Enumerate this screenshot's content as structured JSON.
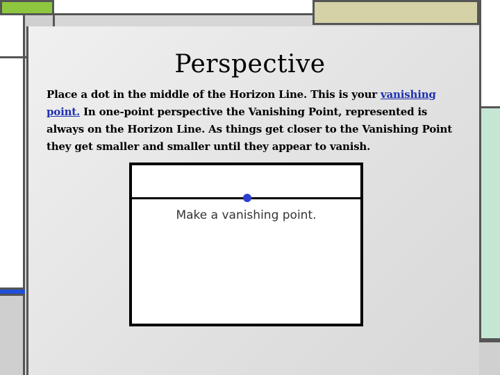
{
  "slide": {
    "title": "Perspective",
    "body": {
      "intro": "Place a dot in the middle of the Horizon Line. This is your ",
      "link": "vanishing point.",
      "rest": " In one-point perspective the Vanishing Point, represented is always on the Horizon Line. As things get closer to the Vanishing Point they get smaller and smaller until they appear to vanish."
    },
    "figure": {
      "caption": "Make a vanishing point."
    }
  },
  "colors": {
    "accent_green": "#8ec63f",
    "accent_blue": "#1f4fd6",
    "link_blue": "#1f2fb0",
    "dot_blue": "#2d3fd0",
    "olive": "#d4d2a6",
    "mint": "#c5e6d3"
  }
}
